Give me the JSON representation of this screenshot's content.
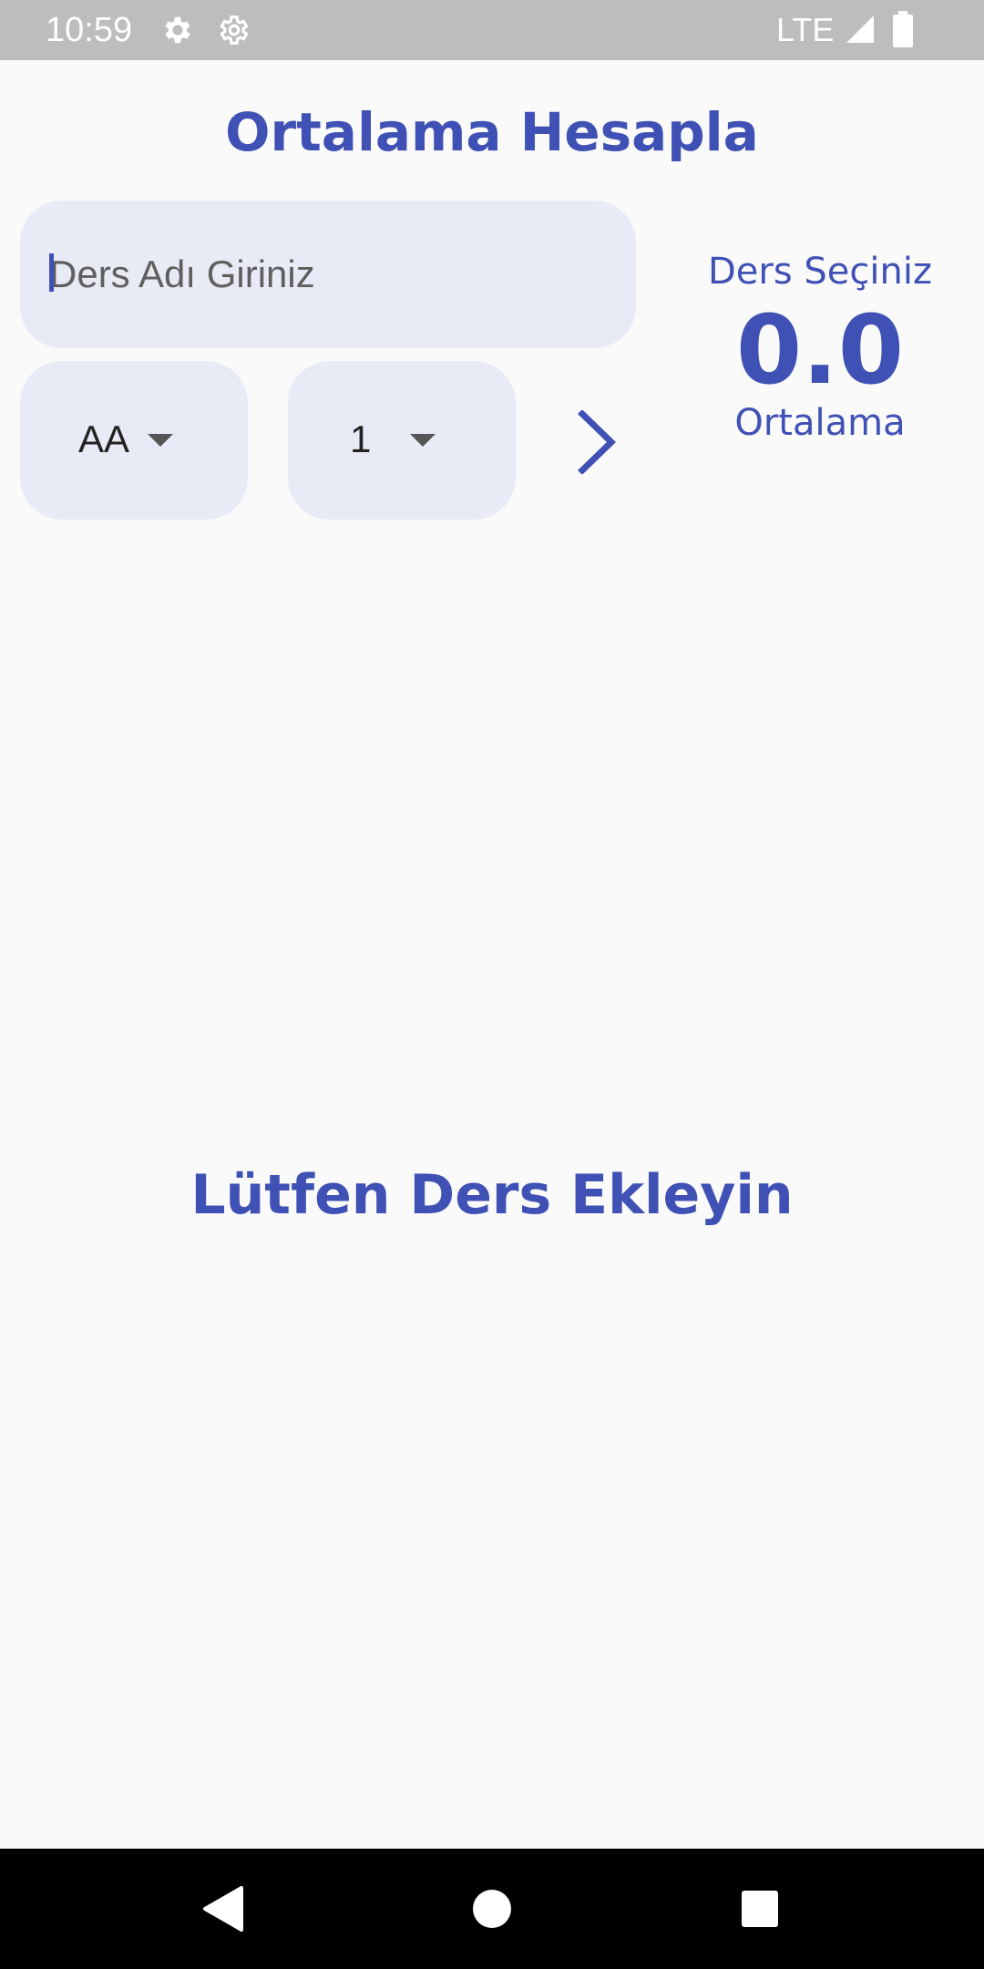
{
  "status_bar": {
    "time": "10:59",
    "network": "LTE",
    "icons": [
      "settings-gear-icon",
      "settings-gear-outline-icon",
      "cell-signal-icon",
      "battery-icon"
    ]
  },
  "app": {
    "title": "Ortalama Hesapla",
    "accent_color": "#3f51b5",
    "field_color": "#e8eaf6"
  },
  "form": {
    "course_name_placeholder": "Ders Adı Giriniz",
    "course_name_value": "",
    "grade_selected": "AA",
    "credit_selected": "1",
    "add_icon": "chevron-right-icon"
  },
  "average": {
    "label_top": "Ders Seçiniz",
    "value": "0.0",
    "label_bottom": "Ortalama"
  },
  "list": {
    "empty_message": "Lütfen Ders Ekleyin"
  },
  "nav_bar": {
    "buttons": [
      "back-icon",
      "home-icon",
      "recents-icon"
    ]
  }
}
